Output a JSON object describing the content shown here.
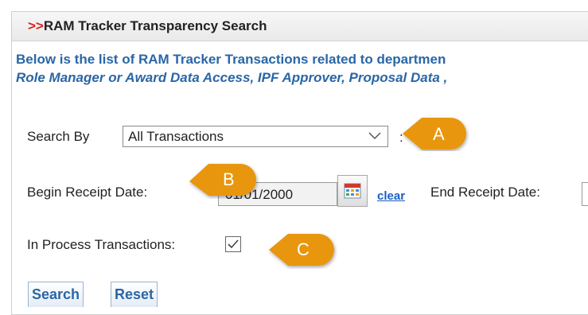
{
  "header": {
    "arrows": ">>",
    "title": "RAM Tracker Transparency Search"
  },
  "intro": {
    "line1": "Below is the list of RAM Tracker Transactions related to departmen",
    "line2": "Role Manager or Award Data Access, IPF Approver, Proposal Data ,"
  },
  "search_by": {
    "label": "Search By",
    "selected": "All Transactions",
    "suffix": ":"
  },
  "begin_date": {
    "label": "Begin Receipt Date:",
    "value": "01/01/2000",
    "clear_label": "clear"
  },
  "end_date": {
    "label": "End Receipt Date:"
  },
  "in_process": {
    "label": "In Process Transactions:",
    "checked": true
  },
  "buttons": {
    "search": "Search",
    "reset": "Reset"
  },
  "callouts": {
    "a": "A",
    "b": "B",
    "c": "C"
  },
  "colors": {
    "callout": "#e8960c",
    "title_arrows": "#e0201e",
    "intro_text": "#2a66a6",
    "link": "#1a5ec2"
  }
}
